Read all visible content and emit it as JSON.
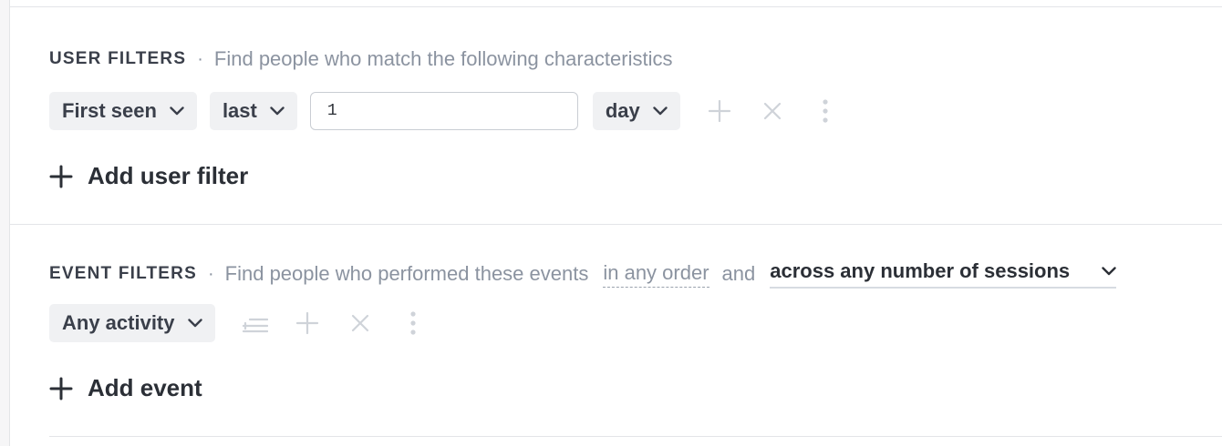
{
  "user_filters": {
    "title": "USER FILTERS",
    "separator": "·",
    "description": "Find people who match the following characteristics",
    "filter_row": {
      "property": "First seen",
      "operator": "last",
      "value": "1",
      "unit": "day"
    },
    "add_label": "Add user filter"
  },
  "event_filters": {
    "title": "EVENT FILTERS",
    "separator": "·",
    "description": "Find people who performed these events",
    "order": "in any order",
    "conjunction": "and",
    "sessions": "across any number of sessions",
    "event_row": {
      "event": "Any activity"
    },
    "add_label": "Add event"
  },
  "colors": {
    "text": "#2b2f36",
    "muted": "#8b93a0",
    "pill_bg": "#f0f1f3",
    "icon_disabled": "#cfd3d9"
  }
}
